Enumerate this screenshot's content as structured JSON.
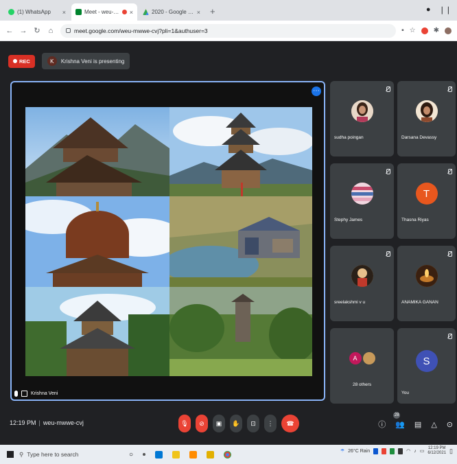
{
  "browser": {
    "tabs": [
      {
        "title": "(1) WhatsApp",
        "favicon_color": "#25d366",
        "active": false
      },
      {
        "title": "Meet - weu-mwwe-cvj",
        "favicon_color": "#00832d",
        "active": true
      },
      {
        "title": "2020 - Google Drive",
        "favicon_color": "#fbbc04",
        "active": false
      }
    ],
    "new_tab": "+",
    "url": "meet.google.com/weu-mwwe-cvj?pli=1&authuser=3"
  },
  "meet": {
    "rec_label": "REC",
    "presenter_initial": "K",
    "presenting_text": "Krishna Veni is presenting",
    "stage_name": "Krishna Veni",
    "participants": [
      {
        "name": "sudha poingan",
        "avatar": "photo",
        "color": "#c9a07a"
      },
      {
        "name": "Darsana Devassy",
        "avatar": "photo",
        "color": "#b88866"
      },
      {
        "name": "Stephy James",
        "avatar": "photo",
        "color": "#c94b6d"
      },
      {
        "name": "Thasna Riyas",
        "avatar": "T",
        "color": "#e8571e"
      },
      {
        "name": "sreelakshmi v u",
        "avatar": "photo",
        "color": "#d8b07e"
      },
      {
        "name": "ANAMIKA GANAN",
        "avatar": "photo",
        "color": "#c47a2a"
      },
      {
        "name": "28 others",
        "avatar": "A",
        "color": "#c2185b"
      },
      {
        "name": "You",
        "avatar": "S",
        "color": "#3f51b5"
      }
    ],
    "time": "12:19 PM",
    "meeting_code": "weu-mwwe-cvj",
    "people_count": "28"
  },
  "taskbar": {
    "search_placeholder": "Type here to search",
    "weather": "26°C Rain",
    "time": "12:19 PM",
    "date": "6/12/2021"
  }
}
